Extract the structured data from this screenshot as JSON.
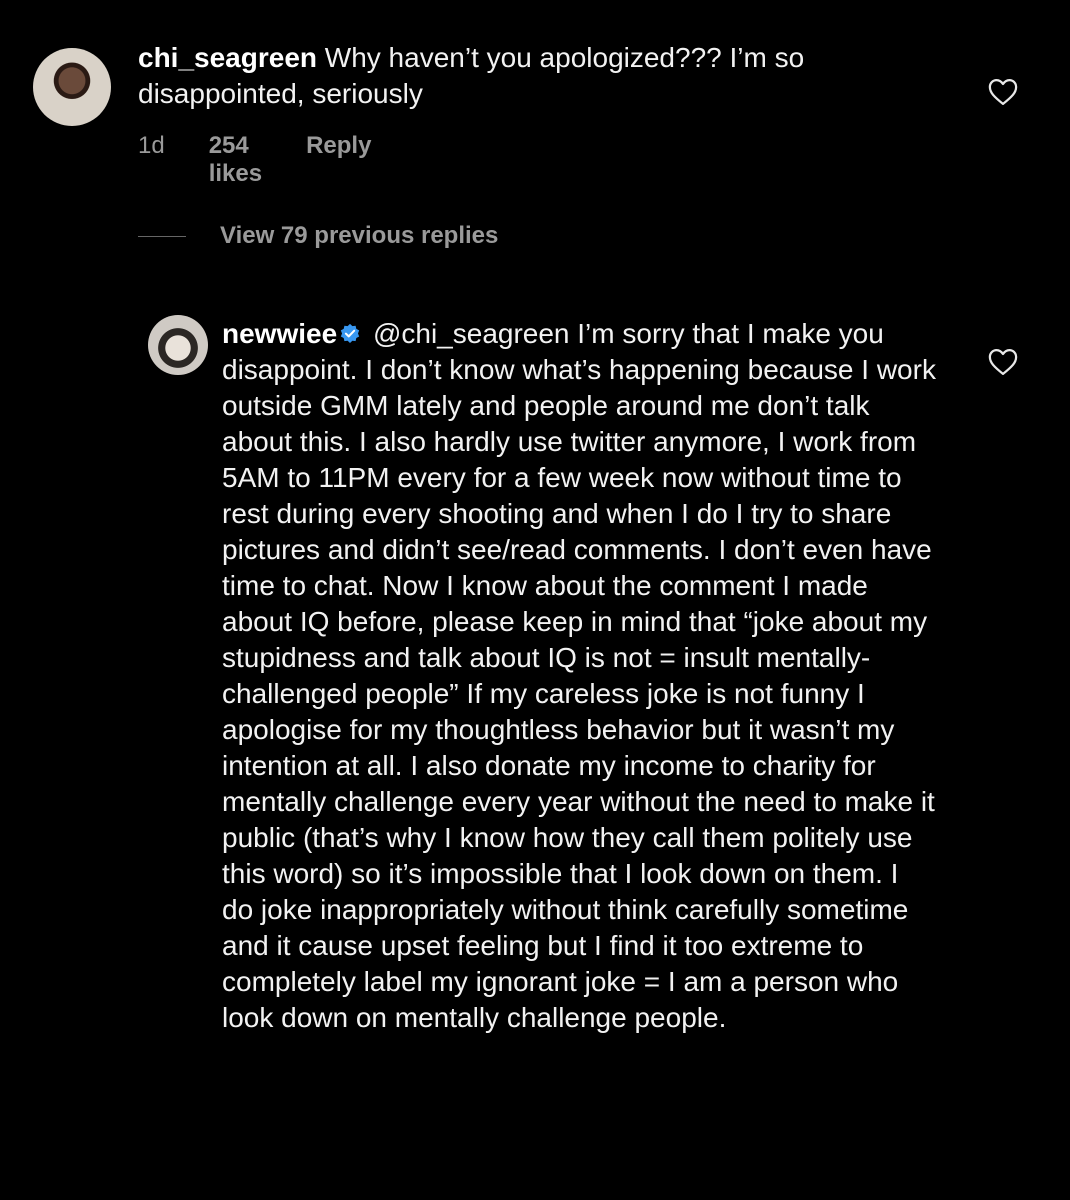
{
  "comments": [
    {
      "username": "chi_seagreen",
      "text": "Why haven’t you apologized??? I’m so disappointed, seriously",
      "time": "1d",
      "likes": "254 likes",
      "reply_label": "Reply"
    },
    {
      "username": "newwiee",
      "verified": true,
      "mention": "@chi_seagreen",
      "text": "I’m sorry that I make you disappoint. I don’t know what’s happening because I work outside GMM lately and people around me don’t talk about this. I also hardly use twitter anymore, I work from 5AM to 11PM every for a few week now without time to rest during every shooting and when I do I try to share pictures and didn’t see/read comments. I don’t even have time to chat. Now I know about the comment I made about IQ before, please keep in mind that “joke about my stupidness and talk about IQ is not = insult mentally-challenged people” If my careless joke is not funny I apologise for my thoughtless behavior but it wasn’t my intention at all. I also donate my income to charity for mentally challenge every year without the need to make it public (that’s why I know how they call them politely use this word) so it’s impossible that I look down on them. I do joke inappropriately without think carefully sometime and it cause upset feeling but I find it too extreme to completely label  my ignorant joke = I am a person who look down on mentally challenge people."
    }
  ],
  "view_replies_label": "View 79 previous replies",
  "icons": {
    "like": "heart-outline-icon",
    "verified": "verified-badge-icon"
  },
  "colors": {
    "background": "#000000",
    "text": "#f2f2f2",
    "muted": "#9a9a9a",
    "verified": "#3897f0"
  }
}
